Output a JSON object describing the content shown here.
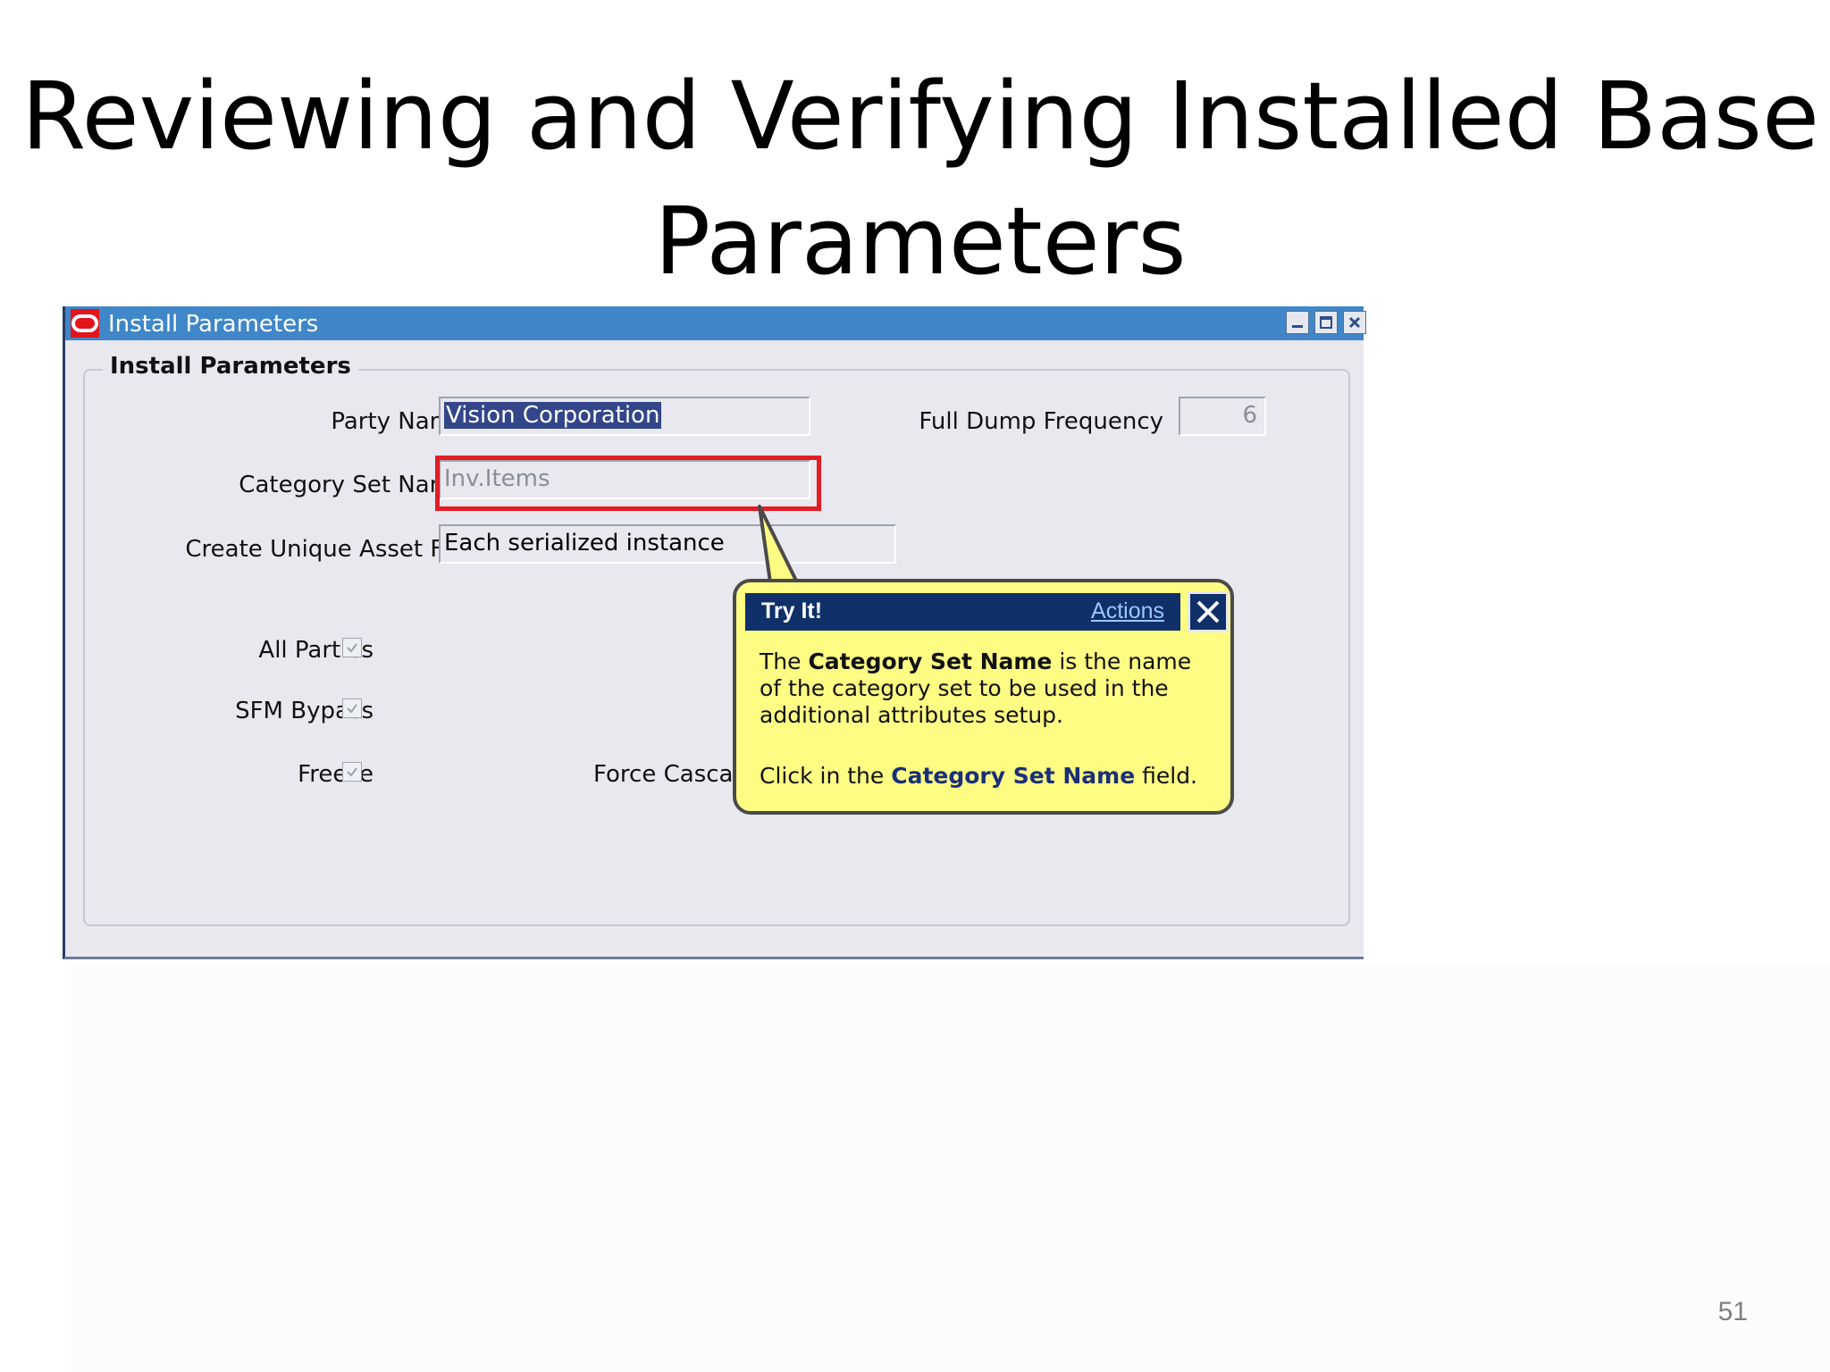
{
  "slide": {
    "title_line1": "Reviewing and Verifying Installed Base",
    "title_line2": "Parameters",
    "page_number": "51"
  },
  "window": {
    "title": "Install Parameters",
    "group_label": "Install Parameters",
    "controls": [
      "minimize-icon",
      "maximize-icon",
      "close-icon"
    ]
  },
  "form": {
    "party_name_label": "Party Name",
    "party_name_value": "Vision Corporation",
    "category_set_label": "Category Set Name",
    "category_set_value": "Inv.Items",
    "create_unique_label": "Create Unique Asset For",
    "create_unique_value": "Each serialized instance",
    "full_dump_label": "Full Dump Frequency",
    "full_dump_value": "6",
    "all_parties_label": "All Parties",
    "sfm_bypass_label": "SFM Bypass",
    "freeze_label": "Freeze",
    "force_cascade_label": "Force Casca",
    "all_parties_checked": true,
    "sfm_bypass_checked": true,
    "freeze_checked": true
  },
  "balloon": {
    "title": "Try It!",
    "actions": "Actions",
    "text_pre": "The ",
    "text_bold": "Category Set Name",
    "text_post": " is the name of the category set to be used in the additional attributes setup.",
    "instr_pre": "Click in the ",
    "instr_bold": "Category Set Name",
    "instr_post": " field.",
    "background": "#fdfc83",
    "header_color": "#10306a"
  },
  "colors": {
    "titlebar": "#3f87c8",
    "highlight": "#e41c24",
    "window_bg": "#e8e8ee"
  }
}
